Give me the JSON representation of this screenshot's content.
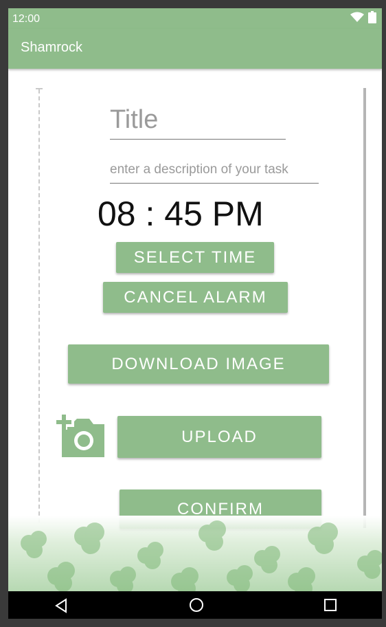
{
  "status_bar": {
    "time": "12:00",
    "wifi_icon": "wifi-icon",
    "battery_icon": "battery-icon"
  },
  "app_bar": {
    "title": "Shamrock"
  },
  "form": {
    "title_placeholder": "Title",
    "description_placeholder": "enter a description of your task",
    "time": "08 : 45 PM"
  },
  "buttons": {
    "select_time": "SELECT TIME",
    "cancel_alarm": "CANCEL ALARM",
    "download_image": "DOWNLOAD IMAGE",
    "upload": "UPLOAD",
    "confirm": "CONFIRM"
  },
  "icons": {
    "add_photo": "add-photo-icon"
  },
  "nav_bar": {
    "back": "back-icon",
    "home": "home-icon",
    "recents": "recents-icon"
  },
  "colors": {
    "accent": "#8fbc8b",
    "background": "#ffffff",
    "nav": "#000000"
  }
}
